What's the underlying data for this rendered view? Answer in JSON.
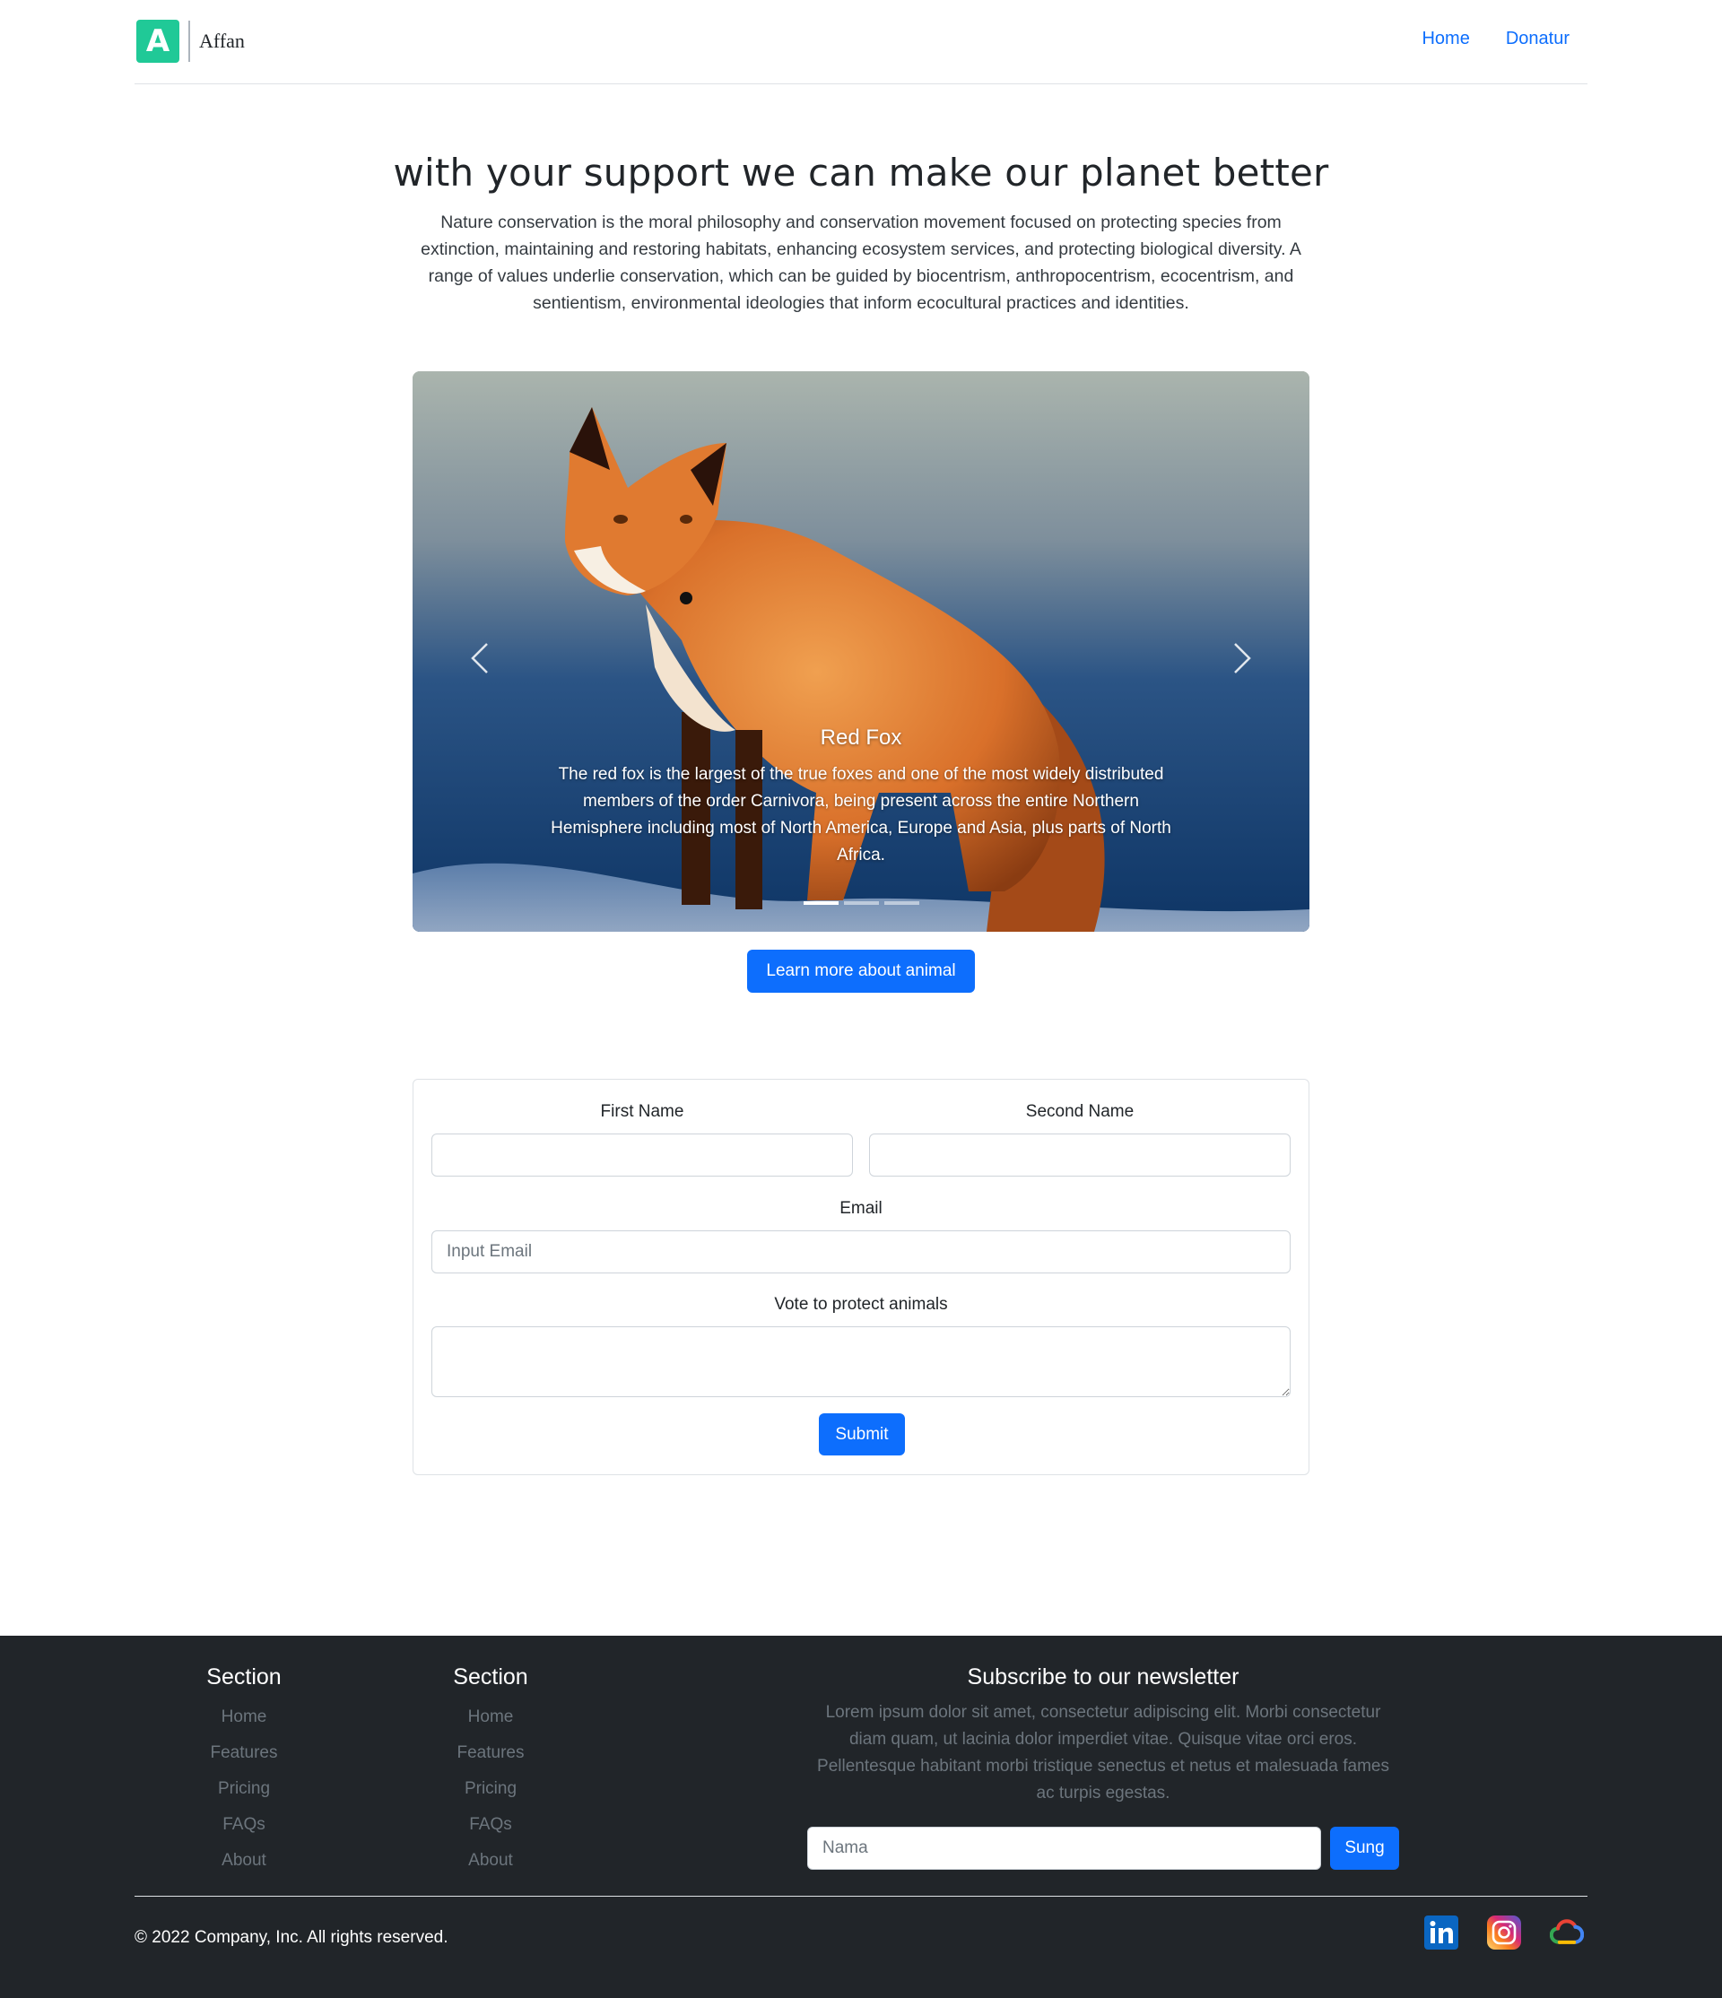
{
  "header": {
    "logo_letter": "A",
    "brand_name": "Affan",
    "nav": [
      {
        "label": "Home"
      },
      {
        "label": "Donatur"
      }
    ]
  },
  "hero": {
    "title": "with your support we can make our planet better",
    "text": "Nature conservation is the moral philosophy and conservation movement focused on protecting species from extinction, maintaining and restoring habitats, enhancing ecosystem services, and protecting biological diversity. A range of values underlie conservation, which can be guided by biocentrism, anthropocentrism, ecocentrism, and sentientism, environmental ideologies that inform ecocultural practices and identities."
  },
  "carousel": {
    "caption_title": "Red Fox",
    "caption_text": "The red fox is the largest of the true foxes and one of the most widely distributed members of the order Carnivora, being present across the entire Northern Hemisphere including most of North America, Europe and Asia, plus parts of North Africa.",
    "slide_count": 3,
    "active_slide": 1,
    "prev_icon": "chevron-left-icon",
    "next_icon": "chevron-right-icon"
  },
  "learn_button": "Learn more about animal",
  "form": {
    "first_name_label": "First Name",
    "second_name_label": "Second Name",
    "email_label": "Email",
    "email_placeholder": "Input Email",
    "vote_label": "Vote to protect animals",
    "submit_label": "Submit"
  },
  "footer": {
    "col1": {
      "title": "Section",
      "links": [
        "Home",
        "Features",
        "Pricing",
        "FAQs",
        "About"
      ]
    },
    "col2": {
      "title": "Section",
      "links": [
        "Home",
        "Features",
        "Pricing",
        "FAQs",
        "About"
      ]
    },
    "newsletter": {
      "title": "Subscribe to our newsletter",
      "text": "Lorem ipsum dolor sit amet, consectetur adipiscing elit. Morbi consectetur diam quam, ut lacinia dolor imperdiet vitae. Quisque vitae orci eros. Pellentesque habitant morbi tristique senectus et netus et malesuada fames ac turpis egestas.",
      "placeholder": "Nama",
      "button": "Sung"
    },
    "copyright": "© 2022 Company, Inc. All rights reserved.",
    "social": [
      "linkedin-icon",
      "instagram-icon",
      "google-cloud-icon"
    ]
  },
  "colors": {
    "primary": "#0d6efd",
    "logo": "#20c997",
    "footer_bg": "#212529"
  }
}
